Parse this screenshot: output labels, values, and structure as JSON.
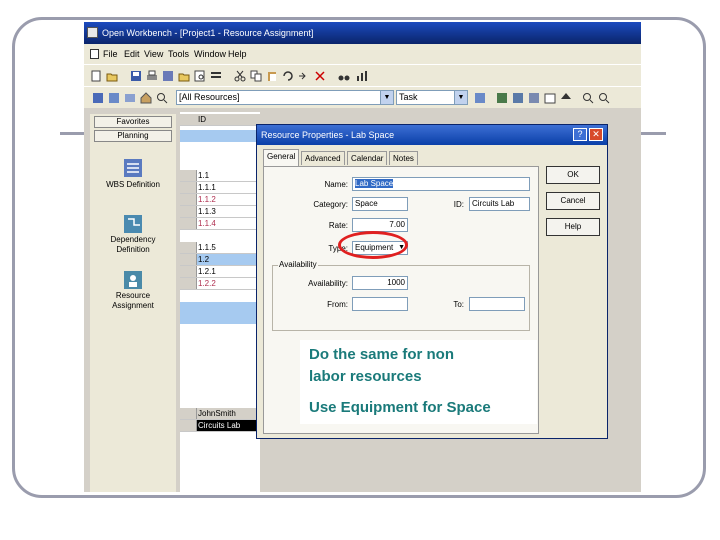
{
  "window": {
    "title": "Open Workbench - [Project1 - Resource Assignment]"
  },
  "menubar": {
    "items": [
      "File",
      "Edit",
      "View",
      "Tools",
      "Window",
      "Help"
    ]
  },
  "toolbar2": {
    "resource_filter": "[All Resources]",
    "view_select": "Task"
  },
  "sidebar": {
    "tabs": [
      "Favorites",
      "Planning"
    ],
    "items": [
      {
        "label": "WBS Definition",
        "icon": "wbs-icon"
      },
      {
        "label": "Dependency Definition",
        "icon": "dependency-icon"
      },
      {
        "label": "Resource Assignment",
        "icon": "resource-icon"
      }
    ]
  },
  "grid": {
    "header": "ID",
    "rows": [
      "1.1",
      "1.1.1",
      "1.1.2",
      "1.1.3",
      "1.1.4",
      "1.1.5",
      "1.2",
      "1.2.1",
      "1.2.2"
    ],
    "resources": [
      "JohnSmith",
      "Circuits Lab"
    ]
  },
  "dialog": {
    "title": "Resource Properties - Lab Space",
    "tabs": [
      "General",
      "Advanced",
      "Calendar",
      "Notes"
    ],
    "labels": {
      "name": "Name:",
      "category": "Category:",
      "id": "ID:",
      "rate": "Rate:",
      "type": "Type:",
      "availability_group": "Availability",
      "availability": "Availability:",
      "from": "From:",
      "to": "To:"
    },
    "values": {
      "name": "Lab Space",
      "category": "Space",
      "id": "Circuits Lab",
      "rate": "7.00",
      "type": "Equipment",
      "availability": "1000",
      "from": "",
      "to": ""
    },
    "buttons": [
      "OK",
      "Cancel",
      "Help"
    ]
  },
  "callout": {
    "line1": "Do the same for non",
    "line2": "labor resources",
    "line3": "Use Equipment for Space"
  },
  "colors": {
    "frame": "#9a9cad",
    "titlebar": "#0a246a",
    "highlight": "#e02020",
    "callout_text": "#1a7a7a"
  }
}
